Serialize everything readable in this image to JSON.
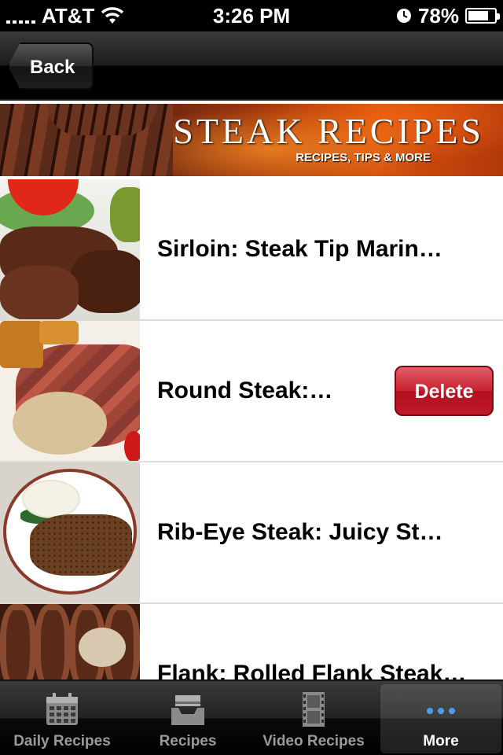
{
  "status_bar": {
    "carrier": "AT&T",
    "time": "3:26 PM",
    "battery": "78%",
    "battery_level": 0.78
  },
  "nav": {
    "back_label": "Back"
  },
  "banner": {
    "title": "STEAK RECIPES",
    "subtitle": "RECIPES, TIPS & MORE"
  },
  "recipes": [
    {
      "title": "Sirloin: Steak Tip Marin…",
      "thumbnail": "sirloin-photo"
    },
    {
      "title": "Round Steak:…",
      "thumbnail": "round-steak-photo",
      "delete_label": "Delete"
    },
    {
      "title": "Rib-Eye Steak: Juicy St…",
      "thumbnail": "rib-eye-photo"
    },
    {
      "title": "Flank: Rolled Flank Steak…",
      "thumbnail": "flank-photo"
    }
  ],
  "tabs": [
    {
      "label": "Daily Recipes",
      "icon": "calendar-icon",
      "active": false
    },
    {
      "label": "Recipes",
      "icon": "inbox-tray-icon",
      "active": false
    },
    {
      "label": "Video Recipes",
      "icon": "film-strip-icon",
      "active": false
    },
    {
      "label": "More",
      "icon": "more-dots-icon",
      "active": true
    }
  ],
  "colors": {
    "delete_red": "#c8202e",
    "active_tab_icon": "#4a9ee8",
    "tab_inactive": "#9a9a9a"
  }
}
